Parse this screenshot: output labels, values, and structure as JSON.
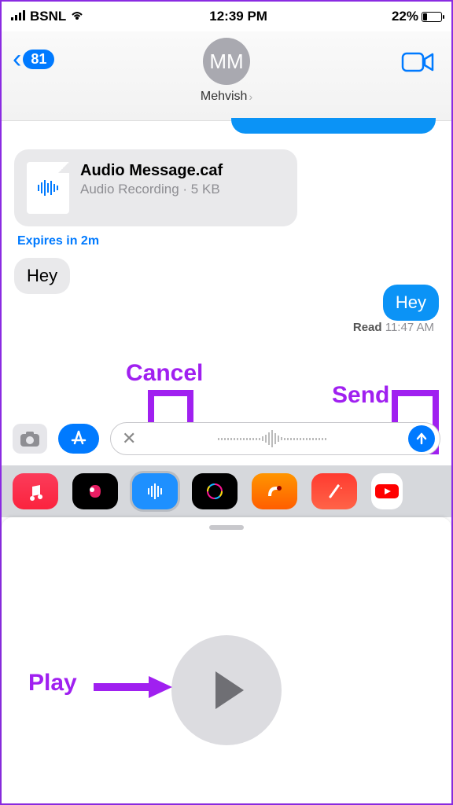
{
  "status": {
    "carrier": "BSNL",
    "time": "12:39 PM",
    "battery_pct": "22%"
  },
  "header": {
    "back_count": "81",
    "avatar_initials": "MM",
    "contact": "Mehvish"
  },
  "messages": {
    "file": {
      "title": "Audio Message.caf",
      "subtitle": "Audio Recording · 5 KB"
    },
    "expires": "Expires in 2m",
    "received_text": "Hey",
    "sent_text": "Hey",
    "read_label": "Read",
    "read_time": "11:47 AM"
  },
  "annotations": {
    "cancel": "Cancel",
    "send": "Send",
    "play": "Play"
  },
  "tray": {
    "icons": [
      "music",
      "photos",
      "audio",
      "draw",
      "garageband",
      "effects",
      "youtube"
    ]
  }
}
